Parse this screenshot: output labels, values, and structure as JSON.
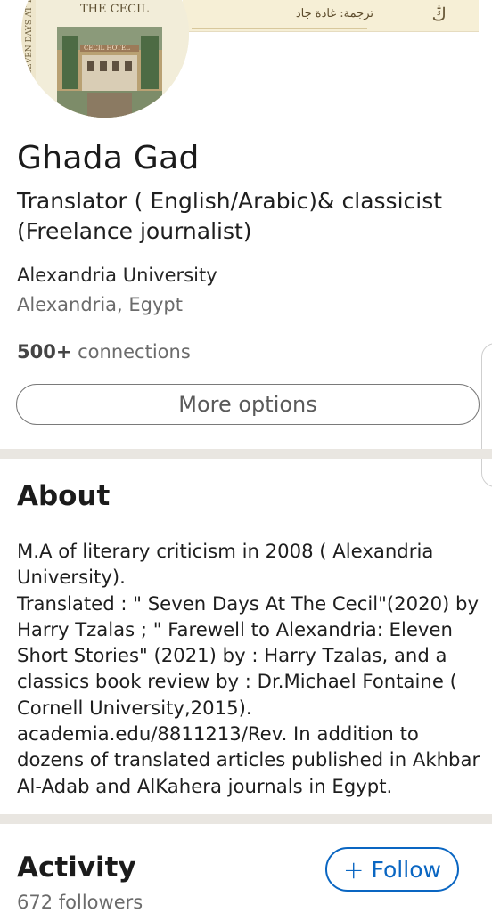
{
  "banner": {
    "text": "ترجمة: غادة جاد",
    "logo_glyph": "ڭ"
  },
  "avatar": {
    "book_title": "THE CECIL",
    "spine_text": "SEVEN DAYS AT THE",
    "sign_text": "CECIL HOTEL"
  },
  "profile": {
    "name": "Ghada Gad",
    "headline": " Translator ( English/Arabic)& classicist (Freelance journalist)",
    "school": "Alexandria University",
    "location": "Alexandria, Egypt",
    "connections_count": "500+",
    "connections_label": " connections",
    "more_options_label": "More options"
  },
  "about": {
    "title": "About",
    "text": "M.A of literary criticism  in 2008 ( Alexandria University).\n    Translated : \" Seven Days At The Cecil\"(2020) by Harry Tzalas ; \" Farewell to Alexandria: Eleven Short Stories\" (2021) by : Harry Tzalas,  and a classics book review  by : Dr.Michael Fontaine ( Cornell University,2015). academia.edu/8811213/Rev.    In addition to dozens of translated articles published in Akhbar Al-Adab and AlKahera journals in Egypt."
  },
  "activity": {
    "title": "Activity",
    "follow_label": "Follow",
    "follow_icon": "plus-icon",
    "followers": "672 followers"
  },
  "colors": {
    "accent": "#0a66c2",
    "divider": "#e9e6e1",
    "banner_bg": "#f6efd6"
  }
}
